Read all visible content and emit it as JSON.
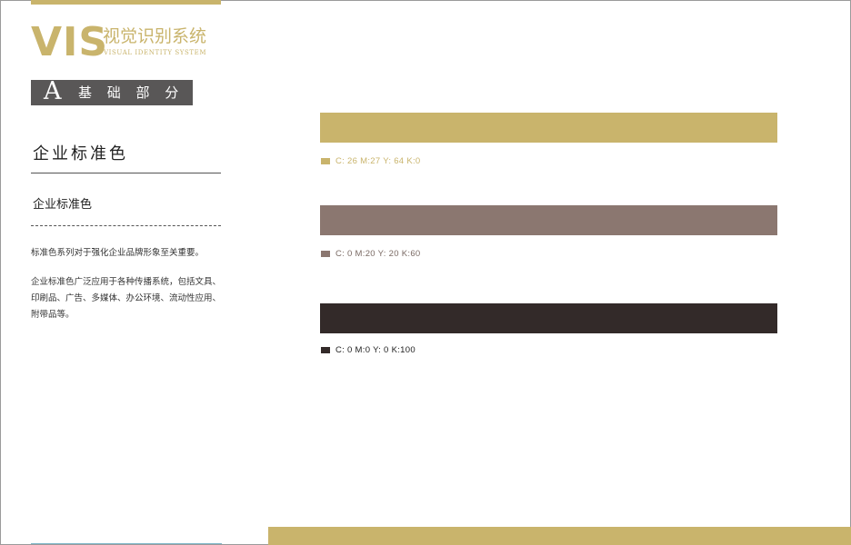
{
  "brand": {
    "logo_main": "VIS",
    "logo_cn": "视觉识别系统",
    "logo_en": "VISUAL IDENTITY SYSTEM",
    "accent_color": "#c9b46c"
  },
  "section": {
    "letter": "A",
    "label": "基 础 部 分"
  },
  "page": {
    "title": "企业标准色",
    "subtitle": "企业标准色",
    "paragraphs": [
      "标准色系列对于强化企业品牌形象至关重要。",
      "企业标准色广泛应用于各种传播系统，包括文具、印刷品、广告、多媒体、办公环境、流动性应用、附带品等。"
    ]
  },
  "swatches": [
    {
      "color": "#c9b46c",
      "text_color": "#c9b46c",
      "spec": "C: 26   M:27   Y: 64   K:0"
    },
    {
      "color": "#8b7770",
      "text_color": "#7a6a64",
      "spec": "C: 0   M:20   Y: 20   K:60"
    },
    {
      "color": "#332a29",
      "text_color": "#222222",
      "spec": "C: 0   M:0   Y: 0  K:100"
    }
  ]
}
